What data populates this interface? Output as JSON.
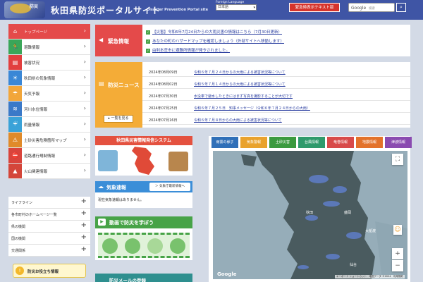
{
  "header": {
    "logo_text": "防災",
    "site_title": "秋田県防災ポータルサイト",
    "site_subtitle": "Disaster Prevention Portal site",
    "lang_label": "Foreign Language",
    "lang_value": "日本語",
    "text_link": "緊急時表示テキスト版",
    "search_brand": "Google",
    "search_placeholder": "検索"
  },
  "nav": {
    "items": [
      {
        "label": "トップページ",
        "color": "#e44a4a"
      },
      {
        "label": "避難情報",
        "color": "#3aa659"
      },
      {
        "label": "被害状況",
        "color": "#e23f3f"
      },
      {
        "label": "秋田県の気象情報",
        "color": "#3a87d6"
      },
      {
        "label": "天気予報",
        "color": "#f2a63a"
      },
      {
        "label": "河川水位情報",
        "color": "#3a79c8"
      },
      {
        "label": "雨量情報",
        "color": "#3aa2d8"
      },
      {
        "label": "土砂災害危険箇所マップ",
        "color": "#e08a2a"
      },
      {
        "label": "道路通行規制情報",
        "color": "#d9443c"
      },
      {
        "label": "火山関連情報",
        "color": "#d4463a"
      }
    ],
    "sub_items": [
      {
        "label": "ライフライン"
      },
      {
        "label": "各市町村のホームページ一覧"
      },
      {
        "label": "県の機関"
      },
      {
        "label": "国の機関"
      },
      {
        "label": "交通関係"
      }
    ],
    "useful_label": "防災お役立ち情報"
  },
  "emergency": {
    "heading": "緊急情報",
    "rows": [
      {
        "text": "【災害】令和6年7月24日からの大雨災害の情報はこちら（7月30日更新）"
      },
      {
        "text": "あなたの町のハザードマップを確認しましょう（外部サイトへ移動します）"
      },
      {
        "text": "由利本荘市に避難所情報が発令されました。"
      }
    ]
  },
  "news": {
    "heading": "防災ニュース",
    "more": "▸ 一覧を見る",
    "items": [
      {
        "date": "2024年08月09日",
        "title": "令和６年７月２４日からの大雨による被害状況等について"
      },
      {
        "date": "2024年08月02日",
        "title": "令和５年７月１４日からの大雨による被害状況等について"
      },
      {
        "date": "2024年07月30日",
        "title": "水没車で避水したときにはまず写真を撮影することが大切です"
      },
      {
        "date": "2024年07月25日",
        "title": "令和６年７月２５日　知事メッセージ（令和６年７月２４日からの大雨）"
      },
      {
        "date": "2024年07月16日",
        "title": "令和６年７月８日からの大雨による被害状況等について"
      }
    ]
  },
  "akita_disaster": {
    "title": "秋田県災害情報発信システム"
  },
  "weather": {
    "heading": "気象速報",
    "button": "＞ 気象庁最新情報へ",
    "body": "現在気象速報はありません。"
  },
  "video": {
    "heading": "動画で防災を学ぼう"
  },
  "mail": {
    "heading": "防災メールの登録"
  },
  "map": {
    "tabs": [
      {
        "label": "雨雲の様子",
        "color": "#2f6fb8"
      },
      {
        "label": "気象警報",
        "color": "#e9a22d"
      },
      {
        "label": "土砂災害",
        "color": "#3b9a3f"
      },
      {
        "label": "台風情報",
        "color": "#2f9a6c"
      },
      {
        "label": "竜巻情報",
        "color": "#d84a4a"
      },
      {
        "label": "地震情報",
        "color": "#e3722b"
      },
      {
        "label": "津波情報",
        "color": "#8a4bb0"
      }
    ],
    "cities": [
      "秋田",
      "盛岡",
      "大船渡",
      "仙台"
    ],
    "google_label": "Google",
    "credit": "キーボード ショートカット　地図データ ©2024　利用規約"
  }
}
